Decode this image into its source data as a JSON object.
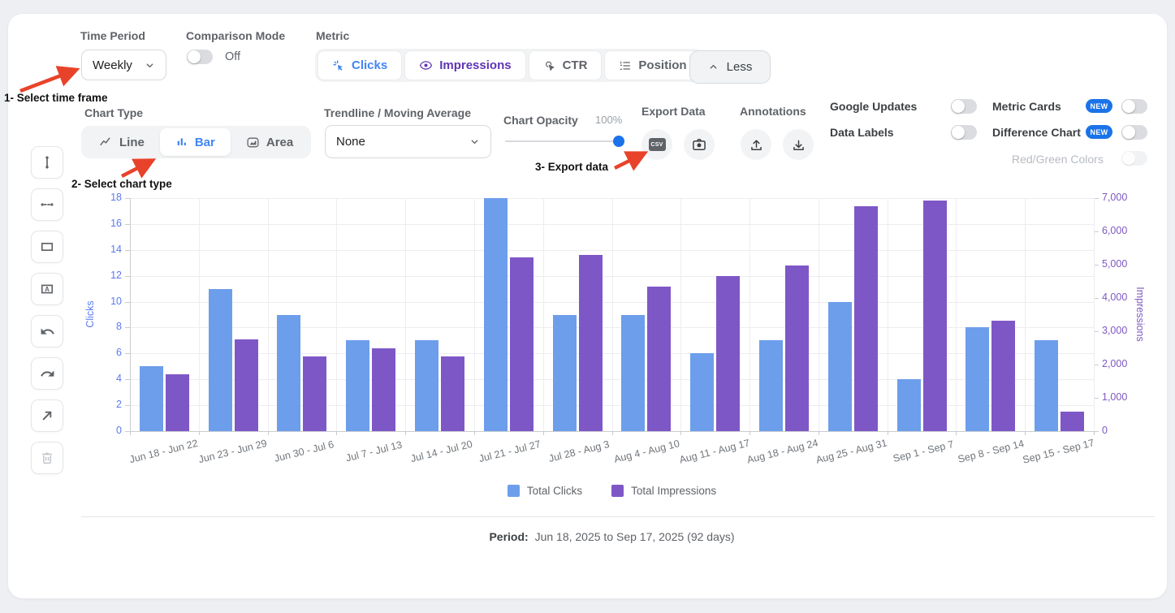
{
  "page": {
    "background": "#edeff2",
    "card_background": "#ffffff"
  },
  "annotations_overlay": {
    "arrow_color": "#e8432a",
    "items": [
      {
        "text": "1- Select time frame"
      },
      {
        "text": "2- Select chart type"
      },
      {
        "text": "3- Export data"
      }
    ]
  },
  "controls": {
    "time_period": {
      "label": "Time Period",
      "value": "Weekly"
    },
    "comparison_mode": {
      "label": "Comparison Mode",
      "state_label": "Off",
      "state": "off"
    },
    "metric": {
      "label": "Metric",
      "options": [
        {
          "label": "Clicks",
          "icon": "cursor-click-icon",
          "selected": true,
          "color": "#4285f4"
        },
        {
          "label": "Impressions",
          "icon": "eye-icon",
          "selected": true,
          "color": "#5f35b3"
        },
        {
          "label": "CTR",
          "icon": "tap-click-icon",
          "selected": false,
          "color": "#5f6368"
        },
        {
          "label": "Position",
          "icon": "numbered-list-icon",
          "selected": false,
          "color": "#5f6368"
        }
      ]
    },
    "less_button": {
      "label": "Less"
    },
    "chart_type": {
      "label": "Chart Type",
      "options": [
        {
          "label": "Line",
          "icon": "line-chart-icon",
          "selected": false
        },
        {
          "label": "Bar",
          "icon": "bar-chart-icon",
          "selected": true
        },
        {
          "label": "Area",
          "icon": "area-chart-icon",
          "selected": false
        }
      ]
    },
    "trendline": {
      "label": "Trendline / Moving Average",
      "value": "None"
    },
    "chart_opacity": {
      "label": "Chart Opacity",
      "value": "100%"
    },
    "export_data": {
      "label": "Export Data",
      "csv_icon_text": "CSV"
    },
    "annotations_section": {
      "label": "Annotations"
    },
    "toggles": {
      "google_updates": {
        "label": "Google Updates",
        "state": "off"
      },
      "data_labels": {
        "label": "Data Labels",
        "state": "off"
      },
      "metric_cards": {
        "label": "Metric Cards",
        "badge": "NEW",
        "state": "off"
      },
      "difference_chart": {
        "label": "Difference Chart",
        "badge": "NEW",
        "state": "off"
      },
      "red_green_colors": {
        "label": "Red/Green Colors",
        "state": "disabled"
      }
    },
    "badge_color": "#1a73e8"
  },
  "chart_data": {
    "type": "bar",
    "categories": [
      "Jun 18 - Jun 22",
      "Jun 23 - Jun 29",
      "Jun 30 - Jul 6",
      "Jul 7 - Jul 13",
      "Jul 14 - Jul 20",
      "Jul 21 - Jul 27",
      "Jul 28 - Aug 3",
      "Aug 4 - Aug 10",
      "Aug 11 - Aug 17",
      "Aug 18 - Aug 24",
      "Aug 25 - Aug 31",
      "Sep 1 - Sep 7",
      "Sep 8 - Sep 14",
      "Sep 15 - Sep 17"
    ],
    "series": [
      {
        "name": "Total Clicks",
        "axis": "left",
        "color": "#6d9eeb",
        "values": [
          5,
          11,
          9,
          7,
          7,
          18,
          9,
          9,
          6,
          7,
          10,
          4,
          8,
          7
        ]
      },
      {
        "name": "Total Impressions",
        "axis": "right",
        "color": "#7e57c7",
        "values": [
          1700,
          2750,
          2250,
          2500,
          2250,
          5230,
          5300,
          4350,
          4670,
          4980,
          6760,
          6930,
          3310,
          580
        ]
      }
    ],
    "left_axis": {
      "label": "Clicks",
      "min": 0,
      "max": 18,
      "ticks": [
        0,
        2,
        4,
        6,
        8,
        10,
        12,
        14,
        16,
        18
      ],
      "color": "#5b7af0"
    },
    "right_axis": {
      "label": "Impressions",
      "min": 0,
      "max": 7000,
      "ticks": [
        0,
        1000,
        2000,
        3000,
        4000,
        5000,
        6000,
        7000
      ],
      "color": "#7e57c2"
    },
    "grid": true,
    "legend_position": "bottom"
  },
  "footer": {
    "period_label": "Period:",
    "period_value": "Jun 18, 2025 to Sep 17, 2025 (92 days)"
  }
}
